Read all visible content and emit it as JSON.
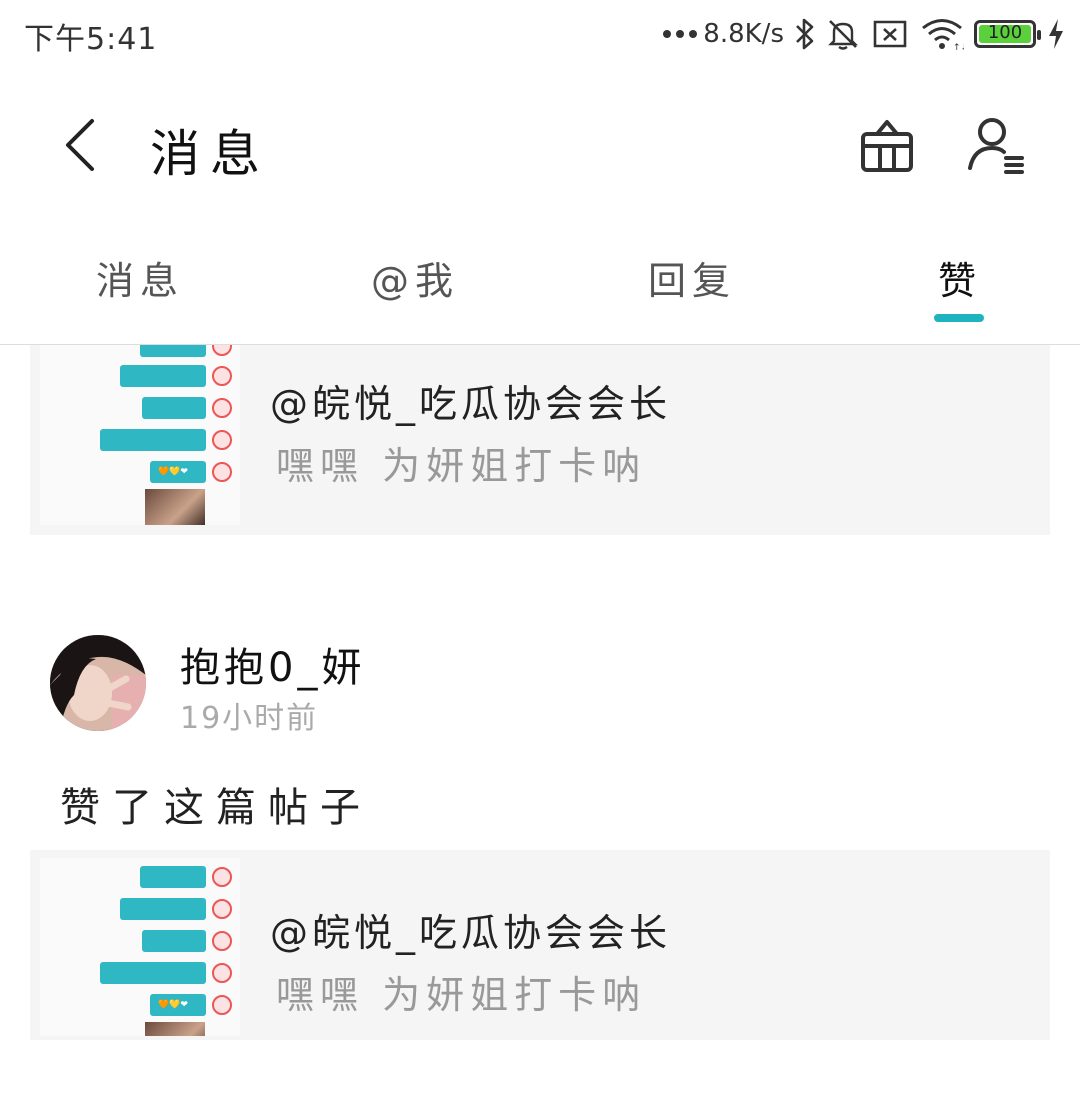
{
  "status_bar": {
    "time": "下午5:41",
    "network_speed": "8.8K/s",
    "battery_level": "100",
    "battery_fraction": 1.0,
    "icons": [
      "dots-icon",
      "bluetooth-icon",
      "bell-off-icon",
      "sim-x-icon",
      "wifi-icon",
      "battery-icon",
      "charging-icon"
    ]
  },
  "header": {
    "title": "消息",
    "icons": [
      "back-icon",
      "gift-icon",
      "user-settings-icon"
    ]
  },
  "tabs": [
    {
      "label": "消息",
      "active": false
    },
    {
      "label": "@我",
      "active": false
    },
    {
      "label": "回复",
      "active": false
    },
    {
      "label": "赞",
      "active": true
    }
  ],
  "colors": {
    "accent": "#1fb3c0",
    "card_bg": "#f5f5f5",
    "muted_text": "#999999"
  },
  "feed": {
    "partial_post": {
      "author": "@皖悦_吃瓜协会会长",
      "text": "嘿嘿 为妍姐打卡呐"
    },
    "item": {
      "username": "抱抱0_妍",
      "time": "19小时前",
      "action": "赞了这篇帖子",
      "post": {
        "author": "@皖悦_吃瓜协会会长",
        "text": "嘿嘿 为妍姐打卡呐"
      }
    }
  }
}
